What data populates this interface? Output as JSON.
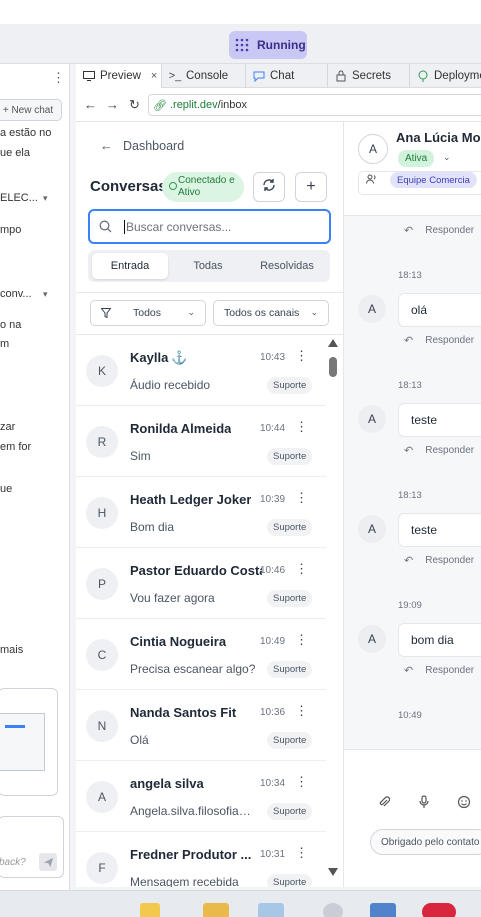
{
  "ide": {
    "run_label": "Running",
    "left_panel": {
      "new_chat": "+ New chat",
      "snippets": [
        "a estão no",
        "ue ela",
        "ELEC...",
        "mpo",
        "conv...",
        "o na",
        "m",
        "zar",
        "em for",
        "ue",
        "mais"
      ],
      "input_placeholder": "back?"
    },
    "tabs": [
      {
        "label": "Preview",
        "icon": "monitor-icon"
      },
      {
        "label": "Console",
        "icon": "terminal-icon"
      },
      {
        "label": "Chat",
        "icon": "chat-icon"
      },
      {
        "label": "Secrets",
        "icon": "lock-icon"
      },
      {
        "label": "Deployme",
        "icon": "deploy-icon"
      }
    ],
    "url_domain": ".replit.dev",
    "url_path": "/inbox"
  },
  "sidebar": {
    "back_label": "Dashboard",
    "title": "Conversas",
    "status_badge": "Conectado e Ativo",
    "search_placeholder": "Buscar conversas...",
    "segments": [
      "Entrada",
      "Todas",
      "Resolvidas"
    ],
    "active_segment": "Entrada",
    "filter_status": "Todos",
    "filter_channel": "Todos os canais"
  },
  "conversations": [
    {
      "initial": "K",
      "name": "Kaylla",
      "anchor": "⚓",
      "time": "10:43",
      "preview": "Áudio recebido",
      "tag": "Suporte"
    },
    {
      "initial": "R",
      "name": "Ronilda Almeida",
      "anchor": "",
      "time": "10:44",
      "preview": "Sim",
      "tag": "Suporte"
    },
    {
      "initial": "H",
      "name": "Heath Ledger Joker",
      "anchor": "",
      "time": "10:39",
      "preview": "Bom dia",
      "tag": "Suporte"
    },
    {
      "initial": "P",
      "name": "Pastor Eduardo Costa",
      "anchor": "",
      "time": "10:46",
      "preview": "Vou fazer agora",
      "tag": "Suporte"
    },
    {
      "initial": "C",
      "name": "Cintia Nogueira",
      "anchor": "",
      "time": "10:49",
      "preview": "Precisa escanear algo?",
      "tag": "Suporte"
    },
    {
      "initial": "N",
      "name": "Nanda Santos Fit",
      "anchor": "",
      "time": "10:36",
      "preview": "Olá",
      "tag": "Suporte"
    },
    {
      "initial": "A",
      "name": "angela silva",
      "anchor": "",
      "time": "10:34",
      "preview": "Angela.silva.filosofia@...",
      "tag": "Suporte"
    },
    {
      "initial": "F",
      "name": "Fredner Produtor ...",
      "anchor": "",
      "time": "10:31",
      "preview": "Mensagem recebida",
      "tag": "Suporte"
    }
  ],
  "chat": {
    "contact_initial": "A",
    "contact_name": "Ana Lúcia Mor",
    "contact_status": "Ativa",
    "team": "Equipe Comercia",
    "reply_label": "Responder",
    "messages": [
      {
        "time": "18:13",
        "text": "olá",
        "initial": "A"
      },
      {
        "time": "18:13",
        "text": "teste",
        "initial": "A"
      },
      {
        "time": "18:13",
        "text": "teste",
        "initial": "A"
      },
      {
        "time": "19:09",
        "text": "bom dia",
        "initial": "A"
      }
    ],
    "last_time": "10:49",
    "quick_reply": "Obrigado pelo contato"
  }
}
